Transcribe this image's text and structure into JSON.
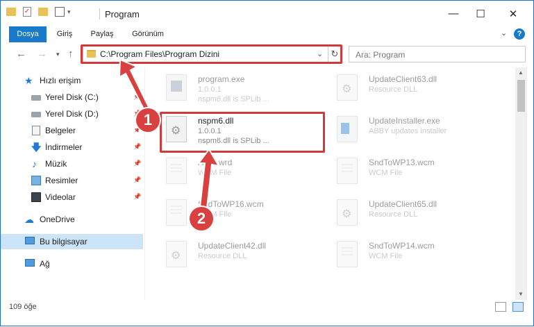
{
  "window": {
    "title": "Program"
  },
  "ribbon": {
    "tabs": [
      "Dosya",
      "Giriş",
      "Paylaş",
      "Görünüm"
    ]
  },
  "address": {
    "path": "C:\\Program Files\\Program Dizini",
    "search_placeholder": "Ara: Program"
  },
  "sidebar": {
    "items": [
      {
        "label": "Hızlı erişim"
      },
      {
        "label": "Yerel Disk (C:)"
      },
      {
        "label": "Yerel Disk (D:)"
      },
      {
        "label": "Belgeler"
      },
      {
        "label": "İndirmeler"
      },
      {
        "label": "Müzik"
      },
      {
        "label": "Resimler"
      },
      {
        "label": "Videolar"
      },
      {
        "label": "OneDrive"
      },
      {
        "label": "Bu bilgisayar"
      },
      {
        "label": "Ağ"
      }
    ]
  },
  "files": {
    "left": [
      {
        "name": "program.exe",
        "line2": "1.0.0.1",
        "line3": "nspm6.dll is SPLib ..."
      },
      {
        "name": "nspm6.dll",
        "line2": "1.0.0.1",
        "line3": "nspm6.dll is SPLib ..."
      },
      {
        "name": "Abcz.wrd",
        "line2": "WCM File",
        "line3": ""
      },
      {
        "name": "SndToWP16.wcm",
        "line2": "WCM File",
        "line3": ""
      },
      {
        "name": "UpdateClient42.dll",
        "line2": "Resource DLL",
        "line3": ""
      }
    ],
    "right": [
      {
        "name": "UpdateClient63.dll",
        "line2": "Resource DLL",
        "line3": ""
      },
      {
        "name": "UpdateInstaller.exe",
        "line2": "ABBY updates installer",
        "line3": ""
      },
      {
        "name": "SndToWP13.wcm",
        "line2": "WCM File",
        "line3": ""
      },
      {
        "name": "UpdateClient65.dll",
        "line2": "Resource DLL",
        "line3": ""
      },
      {
        "name": "SndToWP14.wcm",
        "line2": "WCM File",
        "line3": ""
      }
    ]
  },
  "status": {
    "count": "109 öğe"
  },
  "annotations": {
    "badge1": "1",
    "badge2": "2",
    "color": "#d8413f"
  }
}
